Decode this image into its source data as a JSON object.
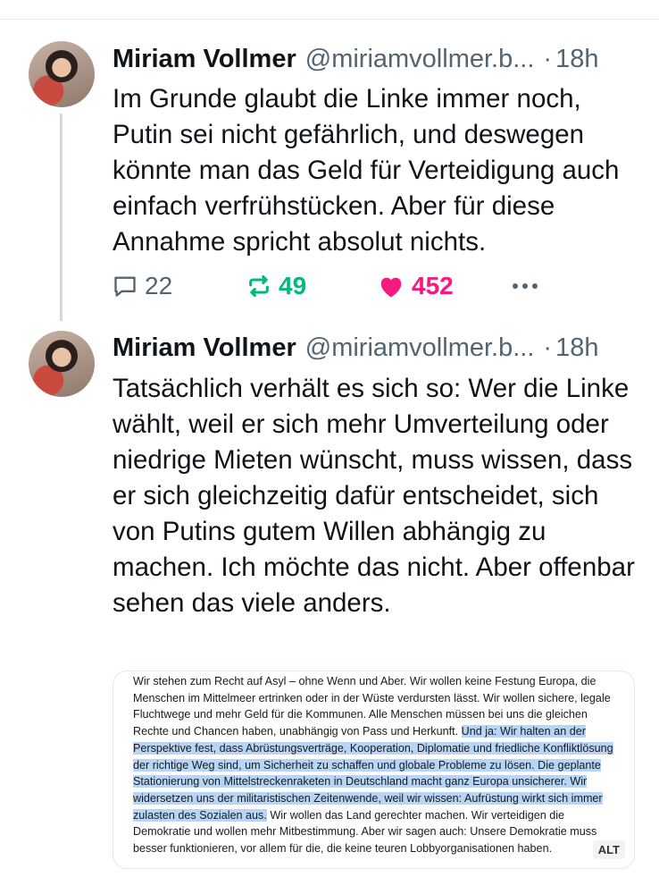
{
  "posts": [
    {
      "author": "Miriam Vollmer",
      "handle": "@miriamvollmer.b...",
      "separator": "·",
      "time": "18h",
      "text": "Im Grunde glaubt die Linke immer noch, Putin sei nicht gefährlich, und deswegen könnte man das Geld für Verteidigung auch einfach verfrühstücken. Aber für diese Annahme spricht absolut nichts.",
      "replies": "22",
      "reposts": "49",
      "likes": "452"
    },
    {
      "author": "Miriam Vollmer",
      "handle": "@miriamvollmer.b...",
      "separator": "·",
      "time": "18h",
      "text": "Tatsächlich verhält es sich so: Wer die Linke wählt, weil er sich mehr Umverteilung oder niedrige Mieten wünscht, muss wissen, dass er sich gleichzeitig dafür entscheidet, sich von Putins gutem Willen abhängig zu machen. Ich möchte das nicht. Aber offenbar sehen das viele anders."
    }
  ],
  "embed": {
    "before": "Wir stehen zum Recht auf Asyl – ohne Wenn und Aber. Wir wollen keine Festung Europa, die Menschen im Mittelmeer ertrinken oder in der Wüste verdursten lässt. Wir wollen sichere, legale Fluchtwege und mehr Geld für die Kommunen. Alle Menschen müssen bei uns die gleichen Rechte und Chancen haben, unabhängig von Pass und Herkunft. ",
    "highlighted": "Und ja: Wir halten an der Perspektive fest, dass Abrüstungsverträge, Kooperation, Diplomatie und friedliche Konfliktlösung der richtige Weg sind, um Sicherheit zu schaffen und globale Probleme zu lösen. Die geplante Stationierung von Mittelstreckenraketen in Deutschland macht ganz Europa unsicherer. Wir widersetzen uns der militaristischen Zeitenwende, weil wir wissen: Aufrüstung wirkt sich immer zulasten des Sozialen aus.",
    "after": " Wir wollen das Land gerechter machen. Wir verteidigen die Demokratie und wollen mehr Mitbestimmung. Aber wir sagen auch: Unsere Demokratie muss besser funktionieren, vor allem für die, die keine teuren Lobbyorganisationen haben.",
    "alt_badge": "ALT"
  },
  "colors": {
    "repost": "#00ba7c",
    "like": "#f91880",
    "muted": "#536471",
    "highlight": "#b7d5f7"
  },
  "icons": [
    "reply-icon",
    "repost-icon",
    "heart-icon",
    "more-icon"
  ]
}
